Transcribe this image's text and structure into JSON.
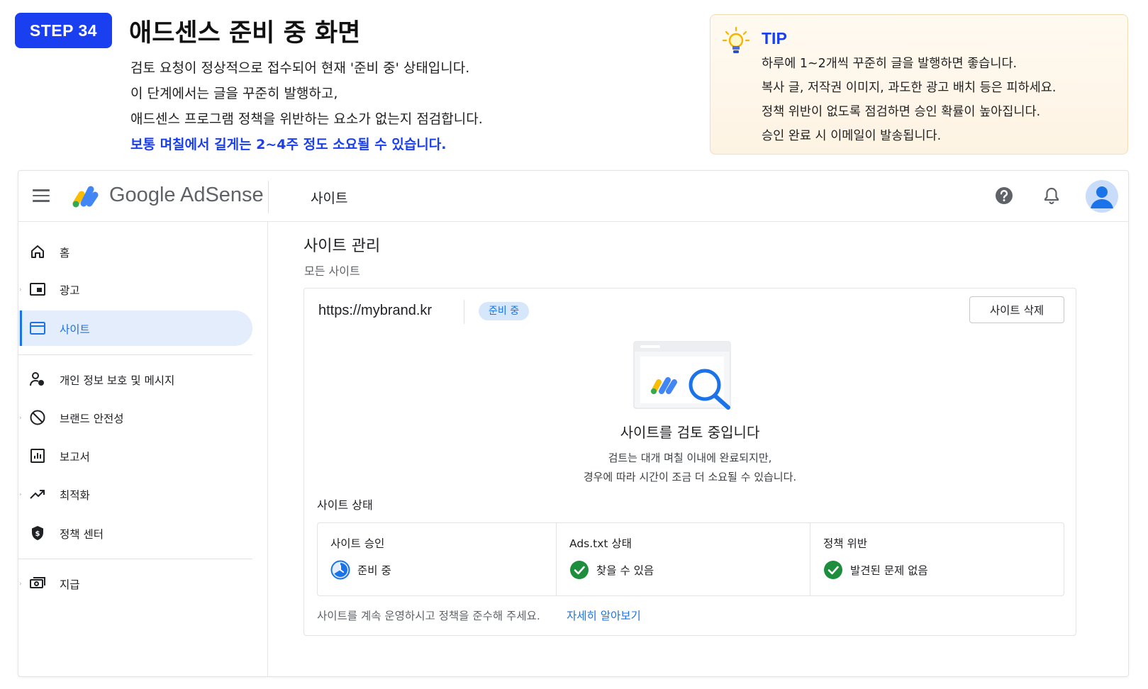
{
  "instruction": {
    "step_badge": "STEP 34",
    "title": "애드센스 준비 중 화면",
    "lines": [
      "검토 요청이 정상적으로 접수되어 현재 '준비 중' 상태입니다.",
      "이 단계에서는 글을 꾸준히 발행하고,",
      "애드센스 프로그램 정책을 위반하는 요소가 없는지 점검합니다."
    ],
    "highlight": "보통 며칠에서 길게는 2~4주 정도 소요될 수 있습니다."
  },
  "tip": {
    "title": "TIP",
    "lines": [
      "하루에 1~2개씩 꾸준히 글을 발행하면 좋습니다.",
      "복사 글, 저작권 이미지, 과도한 광고 배치 등은 피하세요.",
      "정책 위반이 없도록 점검하면 승인 확률이 높아집니다.",
      "승인 완료 시 이메일이 발송됩니다."
    ],
    "icon": "lightbulb-icon"
  },
  "topbar": {
    "logo_text": "Google AdSense",
    "section": "사이트"
  },
  "sidebar": {
    "items": [
      {
        "label": "홈",
        "icon": "home-icon"
      },
      {
        "label": "광고",
        "icon": "ads-icon"
      },
      {
        "label": "사이트",
        "icon": "sites-icon",
        "active": true
      },
      {
        "label": "개인 정보 보호 및 메시지",
        "icon": "privacy-icon"
      },
      {
        "label": "브랜드 안전성",
        "icon": "block-icon"
      },
      {
        "label": "보고서",
        "icon": "reports-icon"
      },
      {
        "label": "최적화",
        "icon": "trending-icon"
      },
      {
        "label": "정책 센터",
        "icon": "shield-icon"
      },
      {
        "label": "지급",
        "icon": "payments-icon"
      }
    ]
  },
  "main": {
    "title": "사이트 관리",
    "subtitle": "모든 사이트",
    "site": {
      "url": "https://mybrand.kr",
      "status_chip": "준비 중",
      "delete_label": "사이트 삭제"
    },
    "review": {
      "title": "사이트를 검토 중입니다",
      "desc_lines": [
        "검트는 대개 며칠 이내에 완료되지만,",
        "경우에 따라 시간이 조금 더 소요될 수 있습니다."
      ]
    },
    "status_heading": "사이트 상태",
    "status_cells": [
      {
        "caption": "사이트 승인",
        "value": "준비 중",
        "icon": "clock-icon"
      },
      {
        "caption": "Ads.txt 상태",
        "value": "찾을 수 있음",
        "icon": "check-circle-icon"
      },
      {
        "caption": "정책 위반",
        "value": "발견된 문제 없음",
        "icon": "check-circle-icon"
      }
    ],
    "footer_note": "사이트를 계속 운영하시고 정책을 준수해 주세요.",
    "footer_link": "자세히 알아보기"
  },
  "colors": {
    "accent_blue": "#1a3ff0",
    "adsense_blue": "#1a73e8",
    "success_green": "#1e8e3e",
    "logo_yellow": "#fbbc04",
    "logo_green": "#34a853",
    "logo_blue": "#4285f4"
  }
}
